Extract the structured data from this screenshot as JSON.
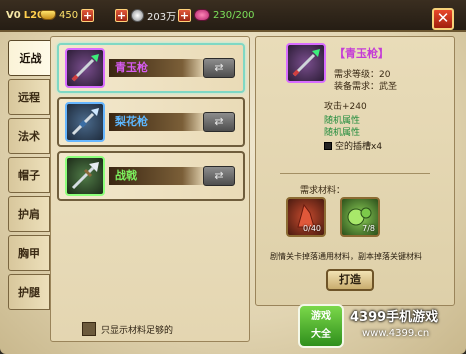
{
  "topbar": {
    "vip": "V0",
    "level": "L20",
    "gold": "450",
    "silver": "203万",
    "stamina": "230/200",
    "close_label": "✕"
  },
  "tabs": [
    {
      "label": "近战",
      "active": true
    },
    {
      "label": "远程",
      "active": false
    },
    {
      "label": "法术",
      "active": false
    },
    {
      "label": "帽子",
      "active": false
    },
    {
      "label": "护肩",
      "active": false
    },
    {
      "label": "胸甲",
      "active": false
    },
    {
      "label": "护腿",
      "active": false
    }
  ],
  "items": [
    {
      "name": "青玉枪",
      "name_color": "#d65bf0",
      "rarity": "purple"
    },
    {
      "name": "梨花枪",
      "name_color": "#5db7ff",
      "rarity": "blue"
    },
    {
      "name": "战戟",
      "name_color": "#7cf05e",
      "rarity": "green"
    }
  ],
  "show_materials_label": "只显示材料足够的",
  "detail": {
    "name": "【青玉枪】",
    "level_req": "需求等级：20",
    "equip_req": "装备需求：武圣",
    "attack": "攻击+240",
    "random1": "随机属性",
    "random2": "随机属性",
    "socket": "空的插槽x4",
    "need_label": "需求材料：",
    "mat1_count": "0/40",
    "mat2_count": "7/8",
    "tip": "剧情关卡掉落通用材料，副本掉落关键材料",
    "forge_label": "打造"
  },
  "watermark": {
    "logo_line1": "游戏",
    "logo_line2": "大全",
    "title": "4399手机游戏",
    "url": "www.4399.cn"
  }
}
